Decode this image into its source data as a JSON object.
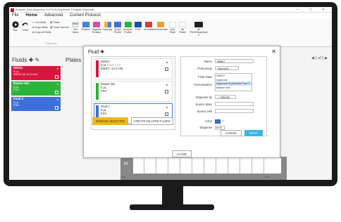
{
  "window": {
    "title": "Analytik Jena dispenser for PIUS/Dispenser II Digital Dispenser",
    "controls": "— ▢ ✕"
  },
  "menu": {
    "items": [
      "File",
      "Home",
      "Advanced",
      "Current Protocol"
    ],
    "active": "Home"
  },
  "ribbon": {
    "run": "Run",
    "undo": "Undo",
    "cut_wells": "Cut Wells",
    "copy_wells": "Copy Wells",
    "copy_all_wells": "Copy All Wells",
    "paste": "Paste",
    "paste_special": "Paste Special",
    "clipboard_label": "Clipboard",
    "set_value": "Set Value",
    "titration": "Titration",
    "targeted_titration": "Targeted Titration",
    "synergy": "Synergy",
    "quick_profile": "Quick Profile",
    "enzyme_profile": "Enzyme Profile",
    "pcr": "PCR",
    "normalize": "Normalize",
    "randomize": "Randomize",
    "dmt_plate": "Dmt Plate",
    "all_plates": "All Plates",
    "pius_dispenser": "All PIUS/Dispenser II"
  },
  "left_panel": {
    "title": "Fluids",
    "cards": [
      {
        "name": "DMSO",
        "line2": "0 µL",
        "line3": "DMSO @ 10.0 mM",
        "color": "#d9163e"
      },
      {
        "name": "Master Mix",
        "line2": "0 µL",
        "line3": "FSG",
        "color": "#2bb33a"
      },
      {
        "name": "Fluid 3",
        "line2": "0 µL",
        "line3": "FSG",
        "color": "#3e6fd9"
      }
    ]
  },
  "plates": {
    "title": "Plates",
    "pager": "1 of 1",
    "row_label": "H"
  },
  "dialog": {
    "title": "Fluid",
    "fluids": [
      {
        "name": "DMSO",
        "line2": "0 µL",
        "line2b": "Fluid 1 (A)",
        "line3": "DMSO: 10.0 mM",
        "color": "#d9163e"
      },
      {
        "name": "Master Mix",
        "line2": "0 µL",
        "line3": "FSG",
        "color": "#2bb33a"
      },
      {
        "name": "Fluid 3",
        "line2": "0 µL",
        "line3": "FSG",
        "color": "#3e6fd9"
      }
    ],
    "remove_button": "REMOVE SELECTED",
    "dilute_button": "CREATE DILUTED FLUIDS",
    "close_button": "CLOSE",
    "properties": {
      "name_label": "Name",
      "name_value": "Water",
      "fluid_group_label": "Fluid group",
      "fluid_group_value": "Aqueous",
      "fluid_class_label": "Fluid class",
      "fluid_class_options": [
        "DMSO",
        "Aqueous",
        "Aqueous Surfactant Free 1",
        "Master Mix"
      ],
      "fluid_class_highlight": "Aqueous Surfactant Free 1",
      "concentration_label": "Concentration",
      "dispense_by_label": "Dispense by",
      "dispense_by_value": "Volume",
      "source_plate_label": "Source plate",
      "source_well_label": "Source well",
      "color_label": "Color",
      "color_value": "#3e6fd9",
      "dispense_label": "Dispense",
      "dispense_value": "No",
      "cancel_button": "CANCEL",
      "apply_button": "APPLY"
    }
  }
}
